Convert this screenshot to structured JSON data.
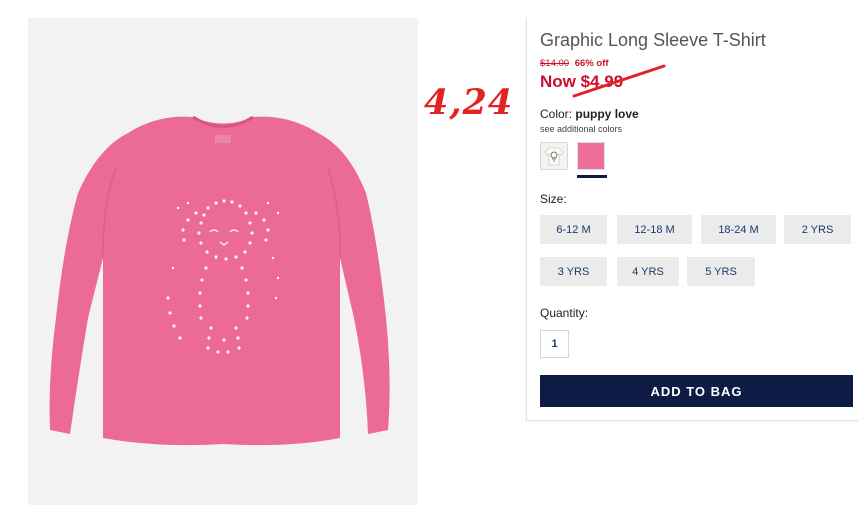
{
  "product": {
    "title": "Graphic Long Sleeve T-Shirt",
    "original_price": "$14.00",
    "discount": "66% off",
    "sale_price": "Now $4.99",
    "color_label": "Color:",
    "color_value": "puppy love",
    "see_colors": "see additional colors",
    "size_label": "Size:",
    "sizes": [
      "6-12 M",
      "12-18 M",
      "18-24 M",
      "2 YRS",
      "3 YRS",
      "4 YRS",
      "5 YRS"
    ],
    "quantity_label": "Quantity:",
    "quantity_value": "1",
    "add_to_bag": "ADD TO BAG"
  },
  "annotation": {
    "handwritten_price": "4,24"
  },
  "colors": {
    "price_red": "#c8102e",
    "navy": "#0d1b45",
    "shirt_pink": "#ec6a96",
    "annotation_red": "#e32222"
  }
}
